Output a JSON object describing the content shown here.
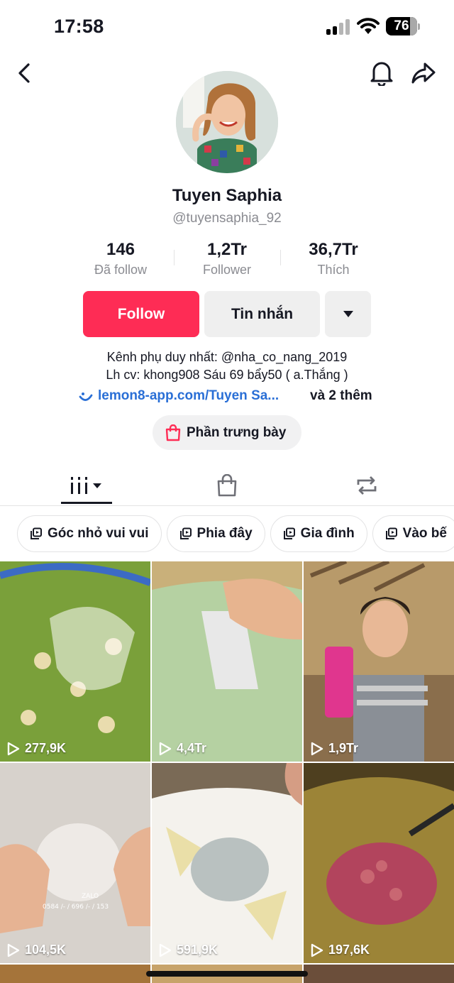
{
  "status_bar": {
    "time": "17:58",
    "battery": "76"
  },
  "profile": {
    "display_name": "Tuyen Saphia",
    "username": "@tuyensaphia_92"
  },
  "stats": {
    "following": {
      "value": "146",
      "label": "Đã follow"
    },
    "followers": {
      "value": "1,2Tr",
      "label": "Follower"
    },
    "likes": {
      "value": "36,7Tr",
      "label": "Thích"
    }
  },
  "actions": {
    "follow_label": "Follow",
    "message_label": "Tin nhắn"
  },
  "bio": {
    "line1": "Kênh phụ duy nhất: @nha_co_nang_2019",
    "line2": "Lh cv: khong908 Sáu 69  bẩy50 ( a.Thắng )",
    "link": "lemon8-app.com/Tuyen Sa...",
    "more": "và 2 thêm"
  },
  "showcase_label": "Phần trưng bày",
  "playlists": [
    "Góc nhỏ vui vui",
    "Phia đây",
    "Gia đình",
    "Vào bế"
  ],
  "videos": [
    {
      "views": "277,9K",
      "color": "#7aa03a"
    },
    {
      "views": "4,4Tr",
      "color": "#a9c79a"
    },
    {
      "views": "1,9Tr",
      "color": "#8a6e4c"
    },
    {
      "views": "104,5K",
      "color": "#c9c3bc"
    },
    {
      "views": "591,9K",
      "color": "#d9d2c6"
    },
    {
      "views": "197,6K",
      "color": "#6b5a2e"
    }
  ],
  "thumbnail_overlay_text": "0584 /- / 696 /- / 153",
  "colors": {
    "accent": "#fe2c55",
    "link": "#2a6fd6"
  }
}
